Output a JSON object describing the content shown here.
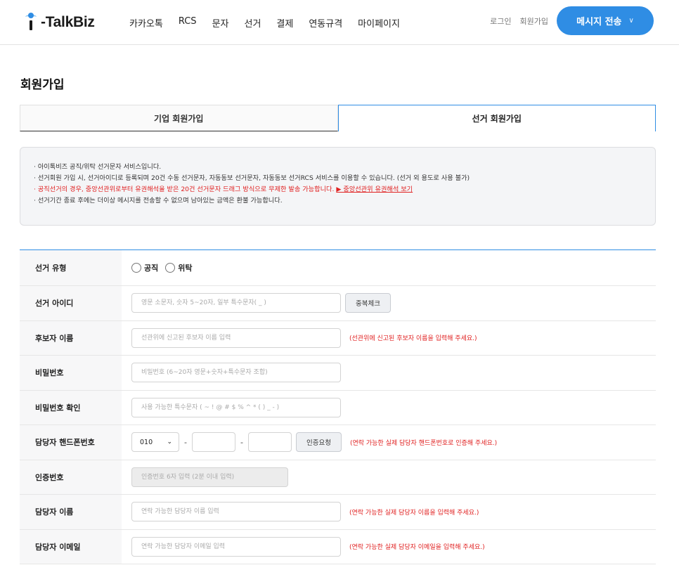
{
  "header": {
    "logo_text": "-TalkBiz",
    "nav": [
      "카카오톡",
      "RCS",
      "문자",
      "선거",
      "결제",
      "연동규격",
      "마이페이지"
    ],
    "login": "로그인",
    "signup": "회원가입",
    "send_button": "메시지 전송",
    "send_chevron": "∨",
    "accent_color": "#2f8de4"
  },
  "page": {
    "title": "회원가입"
  },
  "tabs": [
    {
      "label": "기업 회원가입",
      "active": false
    },
    {
      "label": "선거 회원가입",
      "active": true
    }
  ],
  "notice": {
    "line1": "· 아이톡비즈 공직/위탁 선거문자 서비스입니다.",
    "line2": "· 선거회원 가입 시, 선거아이디로 등록되며 20건 수동 선거문자, 자동동보 선거문자, 자동동보 선거RCS 서비스를 이용할 수 있습니다. (선거 외 용도로 사용 불가)",
    "line3": "· 공직선거의 경우, 중앙선관위로부터 유권해석을 받은 20건 선거문자 드래그 방식으로 무제한 발송 가능합니다.",
    "line3_link": "▶ 중앙선관위 유권해석 보기",
    "line4": "· 선거기간 종료 후에는 더이상 메시지를 전송할 수 없으며 남아있는 금액은 환불 가능합니다."
  },
  "form": {
    "election_type": {
      "label": "선거 유형",
      "options": [
        "공직",
        "위탁"
      ]
    },
    "election_id": {
      "label": "선거 아이디",
      "placeholder": "영문 소문자, 숫자 5~20자, 일부 특수문자( _ )",
      "button": "중복체크"
    },
    "candidate_name": {
      "label": "후보자 이름",
      "placeholder": "선관위에 신고된 후보자 이름 입력",
      "hint": "(선관위에 신고된 후보자 이름을 입력해 주세요.)"
    },
    "password": {
      "label": "비밀번호",
      "placeholder": "비밀번호 (6~20자 영문+숫자+특수문자 조합)"
    },
    "password_confirm": {
      "label": "비밀번호 확인",
      "placeholder": "사용 가능한 특수문자 ( ~ ! @ # $ % ^ * ( ) _ - )"
    },
    "phone": {
      "label": "담당자 핸드폰번호",
      "prefix": "010",
      "caret": "⌄",
      "dash": "-",
      "button": "인증요청",
      "hint": "(연락 가능한 실제 담당자 핸드폰번호로 인증해 주세요.)"
    },
    "auth_code": {
      "label": "인증번호",
      "placeholder": "인증번호 6자 입력 (2분 이내 입력)"
    },
    "manager_name": {
      "label": "담당자 이름",
      "placeholder": "연락 가능한 담당자 이름 입력",
      "hint": "(연락 가능한 실제 담당자 이름을 입력해 주세요.)"
    },
    "manager_email": {
      "label": "담당자 이메일",
      "placeholder": "연락 가능한 담당자 이메일 입력",
      "hint": "(연락 가능한 실제 담당자 이메일을 입력해 주세요.)"
    }
  }
}
